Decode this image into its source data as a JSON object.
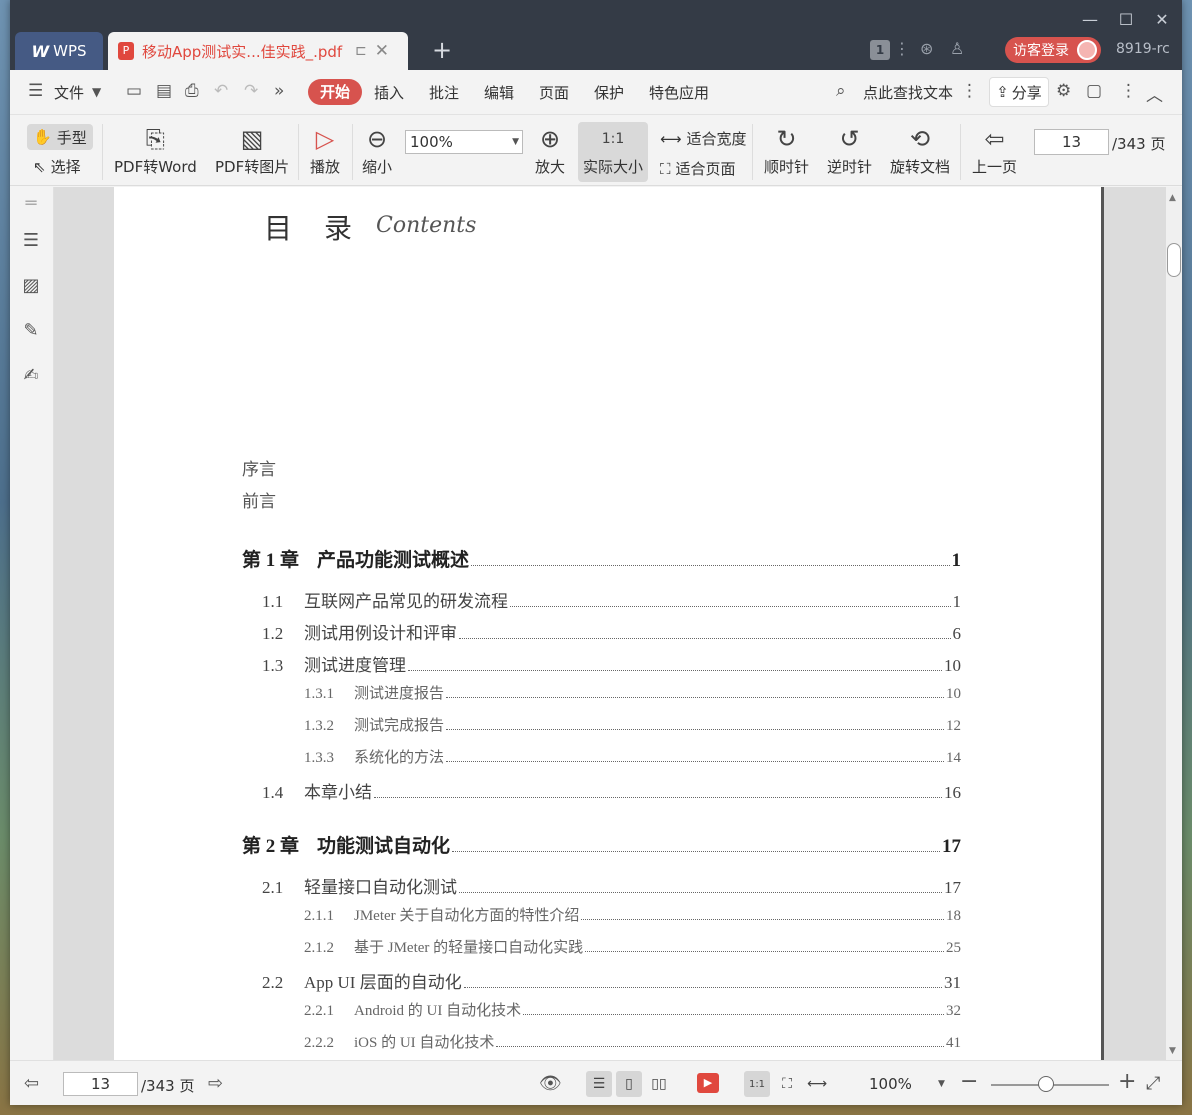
{
  "titlebar": {
    "wps_label": "WPS",
    "doc_tab_label": "移动App测试实...佳实践_.pdf",
    "badge_count": "1",
    "login_label": "访客登录",
    "user_id": "8919-rc",
    "controls": [
      "minimize-icon",
      "maximize-icon",
      "close-icon"
    ]
  },
  "menubar": {
    "file_label": "文件",
    "tabs": [
      "开始",
      "插入",
      "批注",
      "编辑",
      "页面",
      "保护",
      "特色应用"
    ],
    "search_label": "点此查找文本",
    "share_label": "分享"
  },
  "ribbon": {
    "hand_label": "手型",
    "select_label": "选择",
    "pdf2word_label": "PDF转Word",
    "pdf2img_label": "PDF转图片",
    "play_label": "播放",
    "zoom_out_label": "缩小",
    "zoom_value": "100%",
    "zoom_in_label": "放大",
    "actual_size_label": "实际大小",
    "fit_width_label": "适合宽度",
    "fit_page_label": "适合页面",
    "clockwise_label": "顺时针",
    "counter_clockwise_label": "逆时针",
    "rotate_doc_label": "旋转文档",
    "prev_page_label": "上一页",
    "page_value": "13",
    "page_total": "/343 页"
  },
  "document": {
    "title": "目　录",
    "title_en": "Contents",
    "preface": [
      "序言",
      "前言"
    ],
    "toc": [
      {
        "level": 0,
        "num": "第 1 章",
        "text": "产品功能测试概述",
        "page": "1"
      },
      {
        "level": 1,
        "num": "1.1",
        "text": "互联网产品常见的研发流程",
        "page": "1"
      },
      {
        "level": 1,
        "num": "1.2",
        "text": "测试用例设计和评审",
        "page": "6"
      },
      {
        "level": 1,
        "num": "1.3",
        "text": "测试进度管理",
        "page": "10"
      },
      {
        "level": 2,
        "num": "1.3.1",
        "text": "测试进度报告",
        "page": "10"
      },
      {
        "level": 2,
        "num": "1.3.2",
        "text": "测试完成报告",
        "page": "12"
      },
      {
        "level": 2,
        "num": "1.3.3",
        "text": "系统化的方法",
        "page": "14"
      },
      {
        "level": 1,
        "num": "1.4",
        "text": "本章小结",
        "page": "16"
      },
      {
        "level": 0,
        "num": "第 2 章",
        "text": "功能测试自动化",
        "page": "17"
      },
      {
        "level": 1,
        "num": "2.1",
        "text": "轻量接口自动化测试",
        "page": "17"
      },
      {
        "level": 2,
        "num": "2.1.1",
        "text": "JMeter 关于自动化方面的特性介绍",
        "page": "18"
      },
      {
        "level": 2,
        "num": "2.1.2",
        "text": "基于 JMeter 的轻量接口自动化实践",
        "page": "25"
      },
      {
        "level": 1,
        "num": "2.2",
        "text": "App UI 层面的自动化",
        "page": "31"
      },
      {
        "level": 2,
        "num": "2.2.1",
        "text": "Android 的 UI 自动化技术",
        "page": "32"
      },
      {
        "level": 2,
        "num": "2.2.2",
        "text": "iOS 的 UI 自动化技术",
        "page": "41"
      }
    ]
  },
  "statusbar": {
    "page_value": "13",
    "page_total": "/343 页",
    "zoom_value": "100%",
    "zoom_slider_fraction": 0.47
  },
  "colors": {
    "accent": "#d7534e",
    "titlebar_bg": "#343b46",
    "wps_tab_bg": "#455a84"
  }
}
